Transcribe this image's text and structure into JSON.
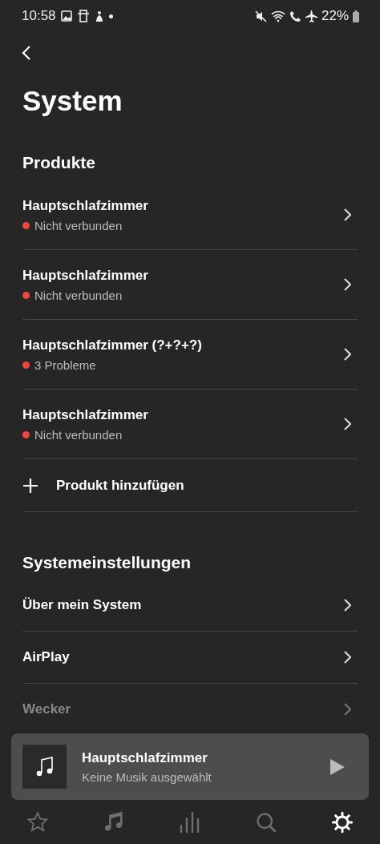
{
  "status_bar": {
    "time": "10:58",
    "battery": "22%"
  },
  "title": "System",
  "products": {
    "heading": "Produkte",
    "items": [
      {
        "name": "Hauptschlafzimmer",
        "status": "Nicht verbunden",
        "color": "#f0463c"
      },
      {
        "name": "Hauptschlafzimmer",
        "status": "Nicht verbunden",
        "color": "#f0463c"
      },
      {
        "name": "Hauptschlafzimmer (?+?+?)",
        "status": "3 Probleme",
        "color": "#f0463c"
      },
      {
        "name": "Hauptschlafzimmer",
        "status": "Nicht verbunden",
        "color": "#f0463c"
      }
    ],
    "add_label": "Produkt hinzufügen"
  },
  "settings": {
    "heading": "Systemeinstellungen",
    "items": [
      {
        "label": "Über mein System",
        "disabled": false
      },
      {
        "label": "AirPlay",
        "disabled": false
      },
      {
        "label": "Wecker",
        "disabled": true
      }
    ]
  },
  "now_playing": {
    "room": "Hauptschlafzimmer",
    "track": "Keine Musik ausgewählt"
  },
  "nav": [
    {
      "kind": "favorites",
      "selected": false
    },
    {
      "kind": "music",
      "selected": false
    },
    {
      "kind": "rooms",
      "selected": false
    },
    {
      "kind": "search",
      "selected": false
    },
    {
      "kind": "settings",
      "selected": true
    }
  ]
}
